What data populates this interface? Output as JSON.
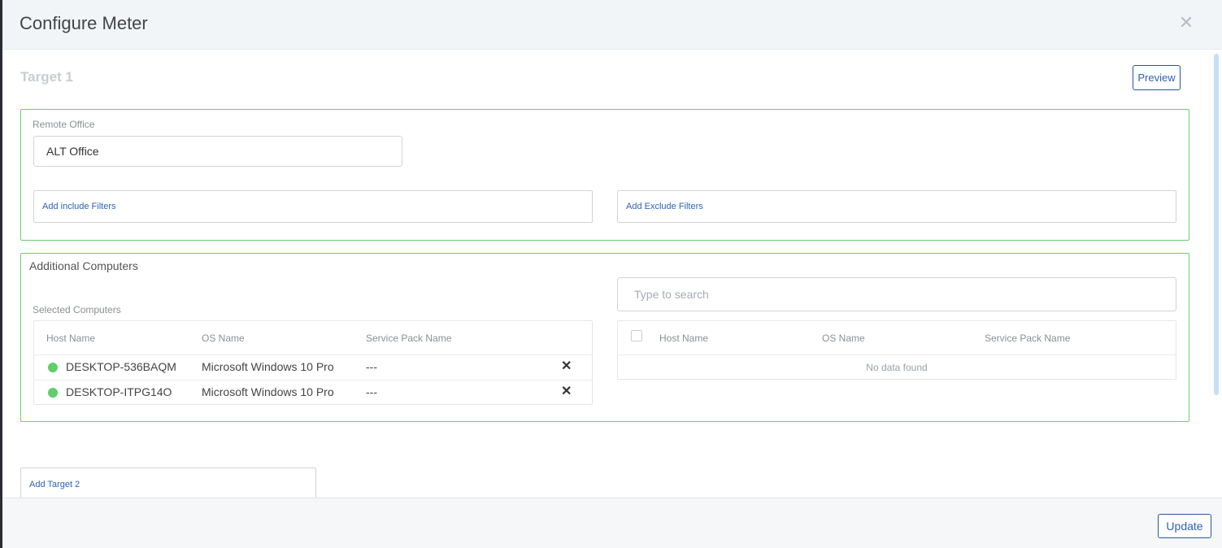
{
  "modal": {
    "title": "Configure Meter",
    "close_icon": "close-icon"
  },
  "target": {
    "title": "Target 1",
    "preview_label": "Preview",
    "remote_office_label": "Remote Office",
    "remote_office_value": "ALT Office",
    "include_filters_label": "Add include Filters",
    "exclude_filters_label": "Add Exclude Filters"
  },
  "additional": {
    "title": "Additional Computers",
    "selected_label": "Selected Computers",
    "columns": [
      "Host Name",
      "OS Name",
      "Service Pack Name"
    ],
    "rows": [
      {
        "host": "DESKTOP-536BAQM",
        "os": "Microsoft Windows 10 Pro",
        "sp": "---",
        "status_color": "#5fce6b"
      },
      {
        "host": "DESKTOP-ITPG14O",
        "os": "Microsoft Windows 10 Pro",
        "sp": "---",
        "status_color": "#5fce6b"
      }
    ],
    "remove_icon": "remove-x-icon",
    "search_placeholder": "Type to search",
    "results_columns": [
      "Host Name",
      "OS Name",
      "Service Pack Name"
    ],
    "no_data": "No data found"
  },
  "add_target_label": "Add Target 2",
  "footer": {
    "update_label": "Update"
  },
  "colors": {
    "accent": "#2f62b6",
    "success": "#5fce6b",
    "section_border": "#6ccf6c"
  }
}
